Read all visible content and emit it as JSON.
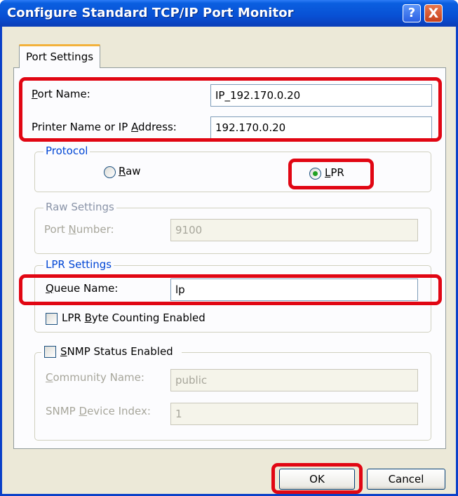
{
  "window": {
    "title": "Configure Standard TCP/IP Port Monitor",
    "help_label": "?",
    "close_label": "X"
  },
  "tabs": [
    {
      "label": "Port Settings",
      "selected": true
    }
  ],
  "port_name": {
    "label_pre": "P",
    "label_rest": "ort Name:",
    "value": "IP_192.170.0.20"
  },
  "printer_address": {
    "label_pre": "Printer Name or IP ",
    "label_u": "A",
    "label_post": "ddress:",
    "value": "192.170.0.20"
  },
  "protocol": {
    "legend": "Protocol",
    "raw": {
      "label_u": "R",
      "label_rest": "aw",
      "selected": false
    },
    "lpr": {
      "label_u": "L",
      "label_rest": "PR",
      "selected": true
    }
  },
  "raw_settings": {
    "legend": "Raw Settings",
    "port_number": {
      "label_pre": "Port ",
      "label_u": "N",
      "label_post": "umber:",
      "value": "9100",
      "enabled": false
    }
  },
  "lpr_settings": {
    "legend": "LPR Settings",
    "queue_name": {
      "label_u": "Q",
      "label_rest": "ueue Name:",
      "value": "lp"
    },
    "byte_counting": {
      "label_pre": "LPR ",
      "label_u": "B",
      "label_post": "yte Counting Enabled",
      "checked": false
    }
  },
  "snmp": {
    "status": {
      "label_u": "S",
      "label_rest": "NMP Status Enabled",
      "checked": false
    },
    "community": {
      "label_u": "C",
      "label_rest": "ommunity Name:",
      "value": "public",
      "enabled": false
    },
    "device_index": {
      "label_pre": "SNMP ",
      "label_u": "D",
      "label_post": "evice Index:",
      "value": "1",
      "enabled": false
    }
  },
  "buttons": {
    "ok": "OK",
    "cancel": "Cancel"
  },
  "colors": {
    "titlebar": "#0A50D4",
    "dialog_bg": "#ECE9D8",
    "highlight": "#E10613",
    "legend": "#0046D5"
  }
}
